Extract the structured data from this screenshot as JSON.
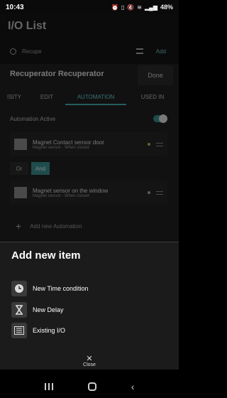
{
  "status_bar": {
    "time": "10:43",
    "icons": [
      "alarm-icon",
      "vibrate-icon",
      "mute-icon",
      "wifi-icon",
      "signal-icon"
    ],
    "battery": "48%"
  },
  "background": {
    "title": "I/O List",
    "search_placeholder": "Recupe",
    "add_label": "Add",
    "panel_title": "Recuperator Recuperator",
    "done_label": "Done",
    "tabs": [
      "ISITY",
      "EDIT",
      "AUTOMATION",
      "USED IN"
    ],
    "automation_active_label": "Automation Active",
    "conditions": [
      {
        "name": "Magnet Contact sensor door",
        "detail": "Magnet sensor - When closed"
      },
      {
        "name": "Magnet sensor on the window",
        "detail": "Magnet sensor - When closed"
      }
    ],
    "logic": {
      "or": "Or",
      "and": "And"
    },
    "add_automation_label": "Add new Automation"
  },
  "sheet": {
    "title": "Add new item",
    "items": [
      {
        "label": "New Time condition",
        "icon": "clock-icon"
      },
      {
        "label": "New Delay",
        "icon": "hourglass-icon"
      },
      {
        "label": "Existing I/O",
        "icon": "list-icon"
      }
    ],
    "close_label": "Close"
  },
  "accent_color": "#3a8a8a"
}
